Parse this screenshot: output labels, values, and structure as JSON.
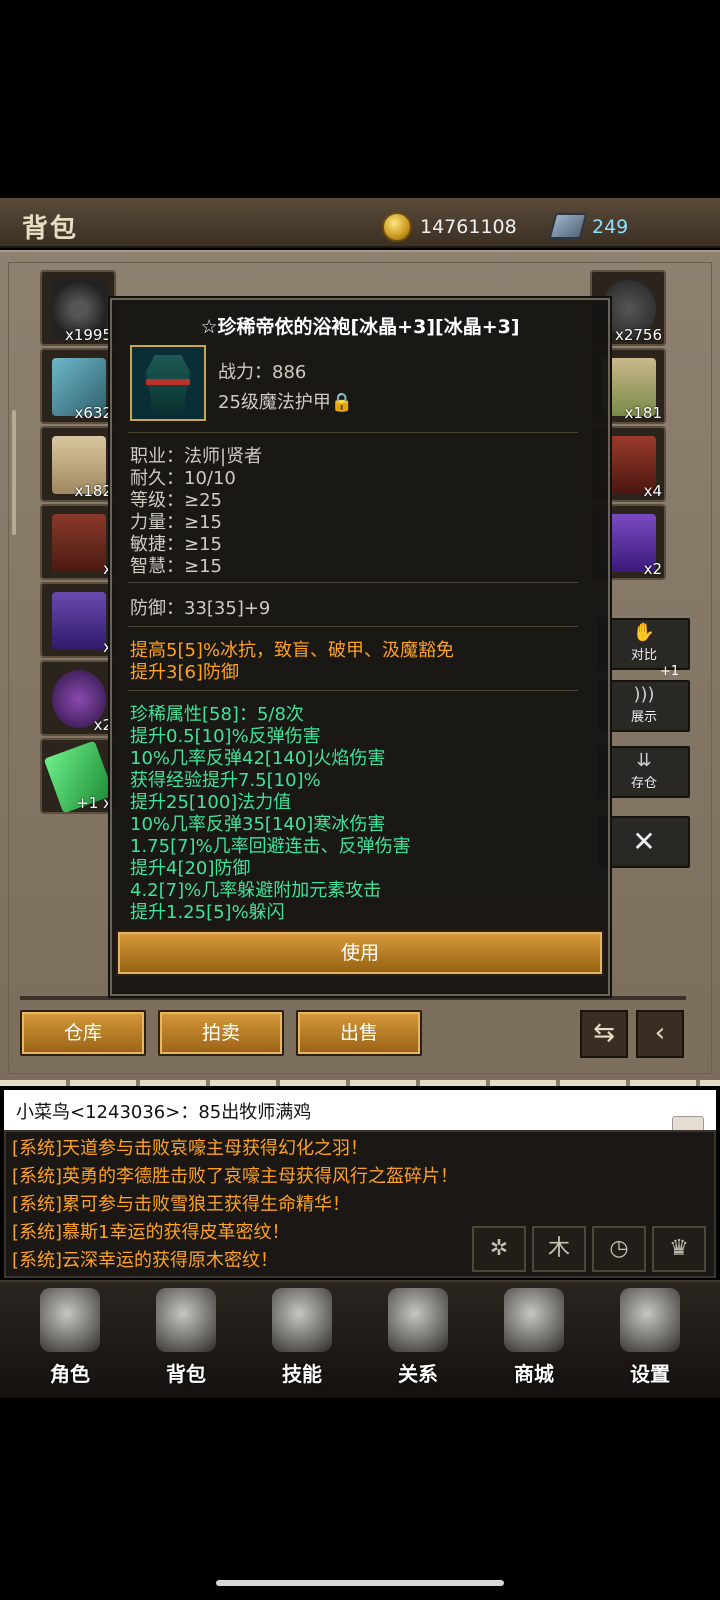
{
  "header": {
    "title": "背包",
    "gold": "14761108",
    "gems": "249"
  },
  "inventory_counts": {
    "slot_0": "x1995",
    "slot_1": "x632",
    "slot_2": "x182",
    "slot_3": "x",
    "slot_4": "x",
    "slot_5": "x2",
    "slot_6": "+1\nx",
    "right_0": "x2756",
    "right_1": "x181",
    "right_2": "x4",
    "right_3": "x2"
  },
  "side_buttons": {
    "compare": "对比",
    "show": "展示",
    "store": "存仓",
    "close": "✕",
    "plus1": "+1"
  },
  "tooltip": {
    "title": "☆珍稀帝依的浴袍[冰晶+3][冰晶+3]",
    "power": "战力：886",
    "type": "25级魔法护甲",
    "reqs": [
      "职业：法师|贤者",
      "耐久：10/10",
      "等级：≥25",
      "力量：≥15",
      "敏捷：≥15",
      "智慧：≥15"
    ],
    "defense": "防御：33[35]+9",
    "bonus": [
      "提高5[5]%冰抗，致盲、破甲、汲魔豁免",
      "提升3[6]防御"
    ],
    "rare": [
      "珍稀属性[58]：5/8次",
      "提升0.5[10]%反弹伤害",
      "10%几率反弹42[140]火焰伤害",
      "获得经验提升7.5[10]%",
      "提升25[100]法力值",
      "10%几率反弹35[140]寒冰伤害",
      "1.75[7]%几率回避连击、反弹伤害",
      "提升4[20]防御",
      "4.2[7]%几率躲避附加元素攻击",
      "提升1.25[5]%躲闪"
    ],
    "use_label": "使用"
  },
  "actions": {
    "warehouse": "仓库",
    "auction": "拍卖",
    "sell": "出售"
  },
  "chat": {
    "last": "小菜鸟<1243036>：85出牧师满鸡",
    "system": [
      "[系统]天道参与击败哀嚎主母获得幻化之羽！",
      "[系统]英勇的李德胜击败了哀嚎主母获得风行之盔碎片！",
      "[系统]累可参与击败雪狼王获得生命精华！",
      "[系统]慕斯1幸运的获得皮革密纹！",
      "[系统]云深幸运的获得原木密纹！"
    ]
  },
  "nav": {
    "items": [
      "角色",
      "背包",
      "技能",
      "关系",
      "商城",
      "设置"
    ]
  },
  "colors": {
    "accent_orange": "#ffa21e",
    "rare_green": "#3fe29a",
    "button_gold": "#d59a3a"
  }
}
